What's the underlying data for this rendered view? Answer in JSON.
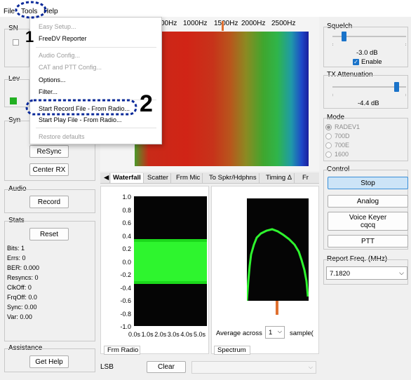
{
  "menubar": {
    "file": "File",
    "tools": "Tools",
    "help": "Help"
  },
  "tools_menu": {
    "easy_setup": "Easy Setup...",
    "freedv_reporter": "FreeDV Reporter",
    "audio_config": "Audio Config...",
    "cat_ptt_config": "CAT and PTT Config...",
    "options": "Options...",
    "filter": "Filter...",
    "start_record": "Start Record File - From Radio...",
    "start_play": "Start Play File - From Radio...",
    "restore_defaults": "Restore defaults"
  },
  "annotations": {
    "step1": "1",
    "step2": "2"
  },
  "left_panel": {
    "snr_label": "SN",
    "level_label": "Lev",
    "sync_label": "Syn",
    "resync_button": "ReSync",
    "center_rx_button": "Center RX",
    "audio_label": "Audio",
    "record_button": "Record",
    "stats_label": "Stats",
    "reset_button": "Reset",
    "stats": {
      "bits": "Bits: 1",
      "errs": "Errs: 0",
      "ber": "BER: 0.000",
      "resyncs": "Resyncs: 0",
      "clkoff": "ClkOff: 0",
      "frqoff": "FrqOff: 0.0",
      "sync": "Sync: 0.00",
      "var": "Var: 0.00"
    },
    "assistance_label": "Assistance",
    "get_help_button": "Get Help"
  },
  "waterfall": {
    "freq_ticks": [
      "00Hz",
      "1000Hz",
      "1500Hz",
      "2000Hz",
      "2500Hz"
    ]
  },
  "tabs": [
    "Waterfall",
    "Scatter",
    "Frm Mic",
    "To Spkr/Hdphns",
    "Timing Δ",
    "Fr"
  ],
  "scope": {
    "y_ticks": [
      "1.0",
      "0.8",
      "0.6",
      "0.4",
      "0.2",
      "0.0",
      "-0.2",
      "-0.4",
      "-0.6",
      "-0.8",
      "-1.0"
    ],
    "x_ticks": [
      "0.0s",
      "1.0s",
      "2.0s",
      "3.0s",
      "4.0s",
      "5.0s"
    ],
    "tab": "Frm Radio"
  },
  "spectrum": {
    "average_label": "Average across",
    "average_value": "1",
    "samples_label": "sample(",
    "tab": "Spectrum"
  },
  "bottom": {
    "mode": "LSB",
    "clear_button": "Clear"
  },
  "right_panel": {
    "squelch_label": "Squelch",
    "squelch_value": "-3.0 dB",
    "squelch_enable": "Enable",
    "squelch_level": 0.12,
    "tx_att_label": "TX Attenuation",
    "tx_att_value": "-4.4 dB",
    "tx_att_level": 0.9,
    "mode_label": "Mode",
    "modes": [
      "RADEV1",
      "700D",
      "700E",
      "1600"
    ],
    "control_label": "Control",
    "stop_button": "Stop",
    "analog_button": "Analog",
    "voice_keyer_button": "Voice Keyer",
    "voice_keyer_sub": "cqcq",
    "ptt_button": "PTT",
    "report_freq_label": "Report Freq. (MHz)",
    "report_freq_value": "7.1820"
  },
  "colors": {
    "accent": "#1a73c9",
    "annotation": "#0b2a9a",
    "scope_green": "#2ef52e"
  }
}
